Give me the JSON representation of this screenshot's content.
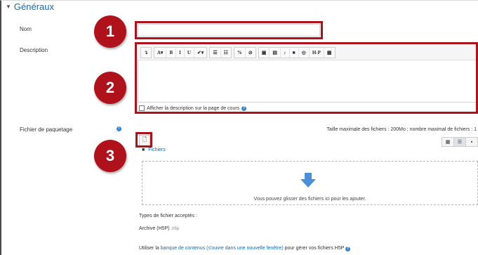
{
  "section": {
    "title": "Généraux"
  },
  "fields": {
    "name_label": "Nom",
    "description_label": "Description",
    "package_label": "Fichier de paquetage"
  },
  "toolbar": {
    "buttons": [
      "↴",
      "A▾",
      "B",
      "I",
      "U",
      "✔▾",
      "☰",
      "☷",
      "%",
      "⊘",
      "▣",
      "▤",
      "♪",
      "■",
      "◎",
      "H-P",
      "▦"
    ]
  },
  "description": {
    "show_on_course_label": "Afficher la description sur la page de cours"
  },
  "filepicker": {
    "max_size_text": "Taille maximale des fichiers : 200Mo ; nombre maximal de fichiers : 1",
    "folder_label": "Fichiers",
    "drop_text": "Vous pouvez glisser des fichiers ici pour les ajouter.",
    "accepted_label": "Types de fichier acceptés :",
    "accepted_type": "Archive (H5P)",
    "accepted_ext": ".h5p"
  },
  "bank": {
    "prefix": "Utiliser la",
    "link": "banque de contenus (s'ouvre dans une nouvelle fenêtre)",
    "suffix": "pour gérer vos fichiers H5P"
  },
  "callouts": [
    "1",
    "2",
    "3"
  ],
  "colors": {
    "accent": "#0f6cbf",
    "callout": "#b0121b",
    "arrow": "#4a90d9"
  }
}
